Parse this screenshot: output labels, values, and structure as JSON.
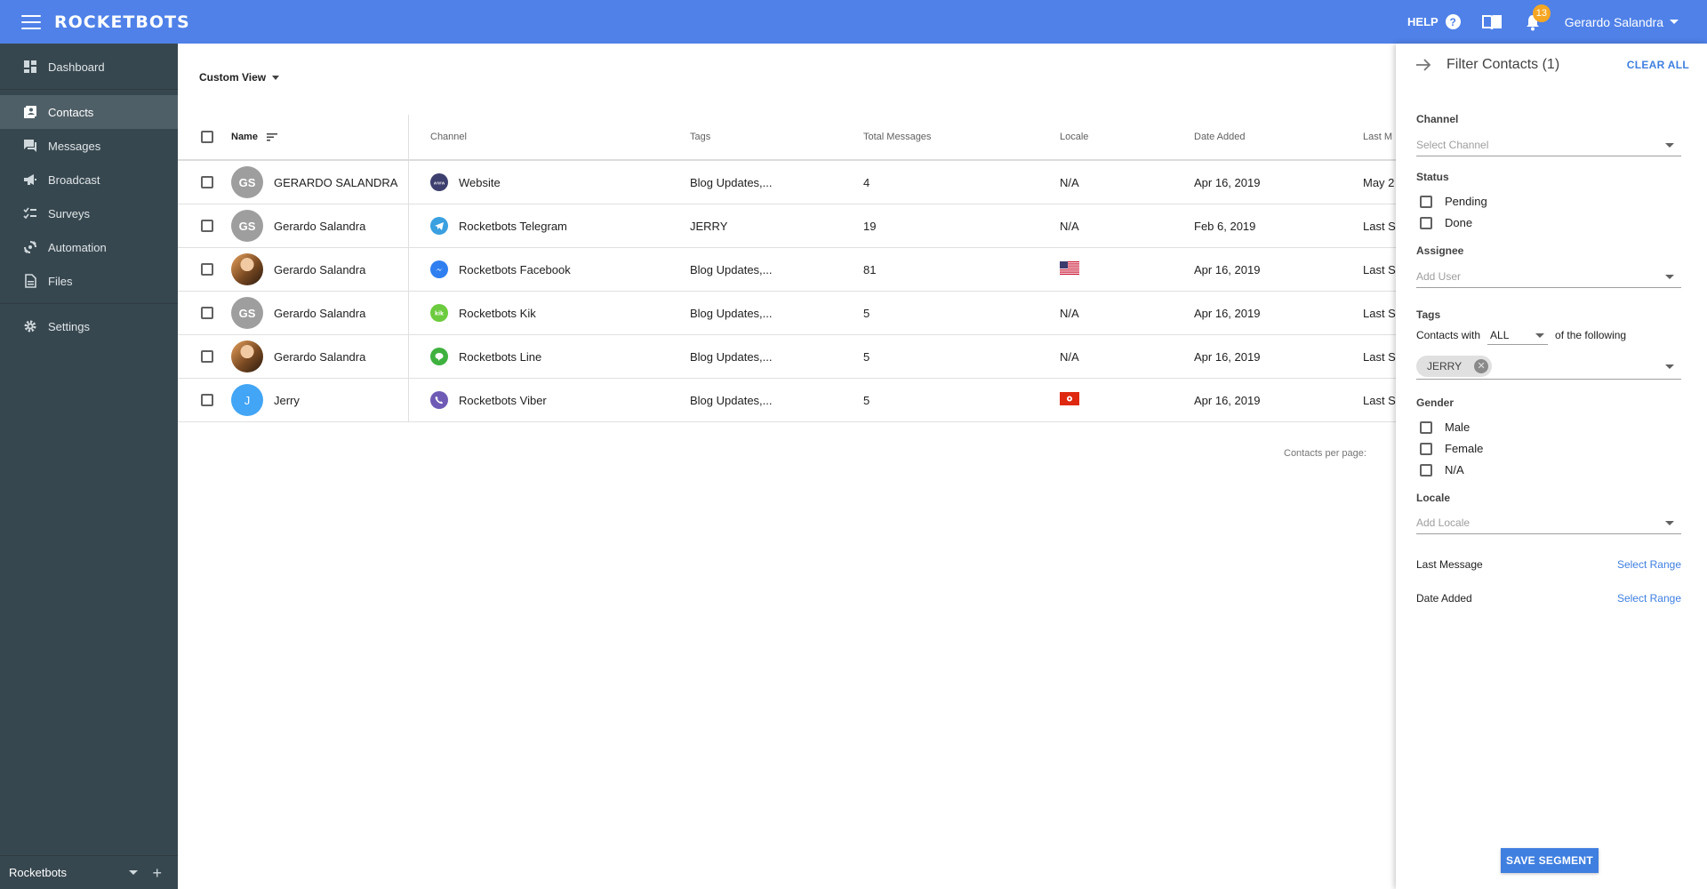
{
  "app": {
    "brand": "ROCKETBOTS"
  },
  "topbar": {
    "help_label": "HELP",
    "help_icon": "?",
    "notifications_count": "13",
    "user_name": "Gerardo Salandra"
  },
  "sidebar": {
    "items": [
      {
        "label": "Dashboard",
        "icon": "dashboard-icon"
      },
      {
        "label": "Contacts",
        "icon": "contacts-icon",
        "active": true
      },
      {
        "label": "Messages",
        "icon": "messages-icon"
      },
      {
        "label": "Broadcast",
        "icon": "broadcast-icon"
      },
      {
        "label": "Surveys",
        "icon": "surveys-icon"
      },
      {
        "label": "Automation",
        "icon": "automation-icon"
      },
      {
        "label": "Files",
        "icon": "files-icon"
      },
      {
        "label": "Settings",
        "icon": "settings-icon"
      }
    ],
    "workspace": "Rocketbots",
    "add_symbol": "+"
  },
  "main": {
    "view_label": "Custom View",
    "columns": [
      "Name",
      "Channel",
      "Tags",
      "Total Messages",
      "Locale",
      "Date Added",
      "Last M"
    ],
    "rows": [
      {
        "initials": "GS",
        "avatar": "grey",
        "name": "GERARDO SALANDRA",
        "channel": "Website",
        "channel_icon": "website-icon",
        "channel_color": "#3d3f6e",
        "tags": "Blog Updates,...",
        "total": "4",
        "locale": "N/A",
        "date_added": "Apr 16, 2019",
        "last": "May 2"
      },
      {
        "initials": "GS",
        "avatar": "grey",
        "name": "Gerardo Salandra",
        "channel": "Rocketbots Telegram",
        "channel_icon": "telegram-icon",
        "channel_color": "#3aa0e0",
        "tags": "JERRY",
        "total": "19",
        "locale": "N/A",
        "date_added": "Feb 6, 2019",
        "last": "Last S"
      },
      {
        "initials": "",
        "avatar": "photo",
        "name": "Gerardo Salandra",
        "channel": "Rocketbots Facebook",
        "channel_icon": "messenger-icon",
        "channel_color": "#2f7ff0",
        "tags": "Blog Updates,...",
        "total": "81",
        "locale": "",
        "locale_flag": "us",
        "date_added": "Apr 16, 2019",
        "last": "Last S"
      },
      {
        "initials": "GS",
        "avatar": "grey",
        "name": "Gerardo Salandra",
        "channel": "Rocketbots Kik",
        "channel_icon": "kik-icon",
        "channel_color": "#6ccb3e",
        "tags": "Blog Updates,...",
        "total": "5",
        "locale": "N/A",
        "date_added": "Apr 16, 2019",
        "last": "Last S"
      },
      {
        "initials": "",
        "avatar": "photo",
        "name": "Gerardo Salandra",
        "channel": "Rocketbots Line",
        "channel_icon": "line-icon",
        "channel_color": "#3fb13f",
        "tags": "Blog Updates,...",
        "total": "5",
        "locale": "N/A",
        "date_added": "Apr 16, 2019",
        "last": "Last S"
      },
      {
        "initials": "J",
        "avatar": "blue",
        "name": "Jerry",
        "channel": "Rocketbots Viber",
        "channel_icon": "viber-icon",
        "channel_color": "#6f5bb5",
        "tags": "Blog Updates,...",
        "total": "5",
        "locale": "",
        "locale_flag": "hk",
        "date_added": "Apr 16, 2019",
        "last": "Last S"
      }
    ],
    "per_page_label": "Contacts per page:"
  },
  "filter": {
    "title": "Filter Contacts (1)",
    "clear_all": "CLEAR ALL",
    "channel": {
      "label": "Channel",
      "placeholder": "Select Channel"
    },
    "status": {
      "label": "Status",
      "options": [
        "Pending",
        "Done"
      ]
    },
    "assignee": {
      "label": "Assignee",
      "placeholder": "Add User"
    },
    "tags": {
      "label": "Tags",
      "prefix": "Contacts with",
      "mode": "ALL",
      "suffix": "of the following",
      "chips": [
        "JERRY"
      ]
    },
    "gender": {
      "label": "Gender",
      "options": [
        "Male",
        "Female",
        "N/A"
      ]
    },
    "locale": {
      "label": "Locale",
      "placeholder": "Add Locale"
    },
    "last_message": {
      "label": "Last Message",
      "action": "Select Range"
    },
    "date_added": {
      "label": "Date Added",
      "action": "Select Range"
    },
    "save_label": "SAVE SEGMENT"
  },
  "colors": {
    "primary": "#4f81e8",
    "sidebar": "#37474f",
    "link": "#3f7fe0",
    "badge": "#f5a623"
  }
}
